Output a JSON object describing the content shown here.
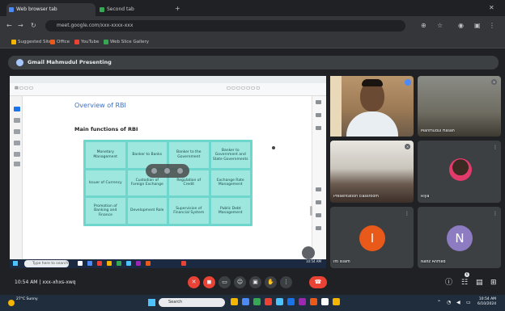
{
  "browser": {
    "tabs": [
      {
        "label": "Web browser tab",
        "active": true
      },
      {
        "label": "Second tab",
        "active": false
      }
    ],
    "address": "meet.google.com/xxx-xxxx-xxx",
    "bookmarks": [
      "Suggested Sites",
      "Office",
      "YouTube",
      "Web Slice Gallery"
    ]
  },
  "meet": {
    "presenting_banner": "Gmail Mahmudul Presenting",
    "meeting_info": "10:54 AM | xxx-xhxs-xwq",
    "document": {
      "heading": "Overview of RBI",
      "subheading": "Main functions of RBI",
      "functions": [
        "Monetary Management",
        "Banker to Banks",
        "Banker to the Government",
        "Banker to Government and State Governments",
        "Issuer of Currency",
        "Custodian of Foreign Exchange",
        "Regulation of Credit",
        "Exchange Rate Management",
        "Promotion of Banking and Finance",
        "Development Role",
        "Supervision of Financial System",
        "Public Debt Management"
      ],
      "search_placeholder": "Type here to search",
      "clock": "10:54 AM"
    },
    "participants": [
      {
        "name": "",
        "type": "video"
      },
      {
        "name": "Mahmudul Hasan",
        "type": "video"
      },
      {
        "name": "Presentation classroom",
        "type": "video"
      },
      {
        "name": "Riya",
        "type": "photo"
      },
      {
        "name": "Ifti Islam",
        "type": "initial",
        "initial": "I",
        "color": "#e8591a"
      },
      {
        "name": "Nafiz Ahmed",
        "type": "initial",
        "initial": "N",
        "color": "#8e7cc3"
      }
    ],
    "controls": {
      "mic_icon": "mic-off-icon",
      "cam_icon": "cam-off-icon"
    }
  },
  "taskbar": {
    "weather": "27°C Sunny",
    "search_label": "Search",
    "time": "10:54 AM",
    "date": "6/10/2024"
  },
  "colors": {
    "accent_red": "#ea4335",
    "grid_teal": "#6fd6cd",
    "meet_bg": "#202124"
  }
}
